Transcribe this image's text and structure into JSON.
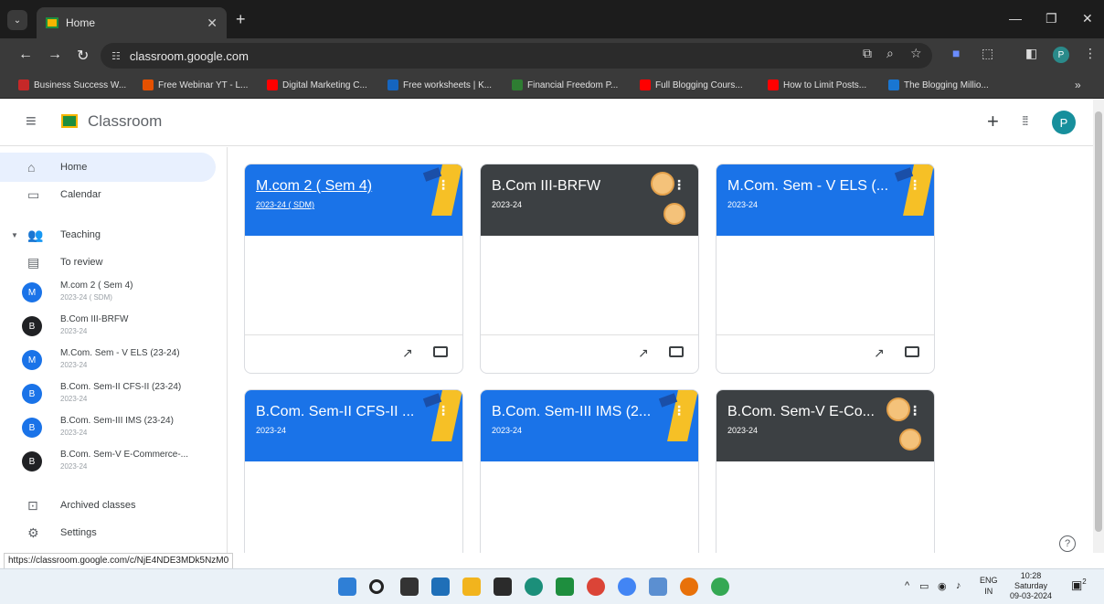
{
  "browser": {
    "tab_title": "Home",
    "url": "classroom.google.com",
    "bookmarks": [
      {
        "label": "Business Success W...",
        "color": "#c62828"
      },
      {
        "label": "Free Webinar YT - L...",
        "color": "#e65100"
      },
      {
        "label": "Digital Marketing C...",
        "color": "#ff0000"
      },
      {
        "label": "Free worksheets | K...",
        "color": "#1565c0"
      },
      {
        "label": "Financial Freedom P...",
        "color": "#2e7d32"
      },
      {
        "label": "Full Blogging Cours...",
        "color": "#ff0000"
      },
      {
        "label": "How to Limit Posts...",
        "color": "#ff0000"
      },
      {
        "label": "The Blogging Millio...",
        "color": "#1976d2"
      }
    ],
    "profile_initial": "P"
  },
  "header": {
    "app_title": "Classroom",
    "avatar_initial": "P"
  },
  "sidebar": {
    "home": "Home",
    "calendar": "Calendar",
    "teaching": "Teaching",
    "to_review": "To review",
    "classes": [
      {
        "initial": "M",
        "name": "M.com 2 ( Sem 4)",
        "sub": "2023-24 ( SDM)",
        "color": "#1a73e8"
      },
      {
        "initial": "B",
        "name": "B.Com III-BRFW",
        "sub": "2023-24",
        "color": "#202124"
      },
      {
        "initial": "M",
        "name": "M.Com. Sem - V ELS (23-24)",
        "sub": "2023-24",
        "color": "#1a73e8"
      },
      {
        "initial": "B",
        "name": "B.Com. Sem-II CFS-II (23-24)",
        "sub": "2023-24",
        "color": "#1a73e8"
      },
      {
        "initial": "B",
        "name": "B.Com. Sem-III IMS (23-24)",
        "sub": "2023-24",
        "color": "#1a73e8"
      },
      {
        "initial": "B",
        "name": "B.Com. Sem-V E-Commerce-...",
        "sub": "2023-24",
        "color": "#202124"
      }
    ],
    "archived": "Archived classes",
    "settings": "Settings"
  },
  "cards": [
    {
      "title": "M.com 2 ( Sem 4)",
      "sub": "2023-24 ( SDM)",
      "bg": "#1a73e8",
      "theme": "blue"
    },
    {
      "title": "B.Com III-BRFW",
      "sub": "2023-24",
      "bg": "#3c4043",
      "theme": "dark"
    },
    {
      "title": "M.Com. Sem - V ELS (...",
      "sub": "2023-24",
      "bg": "#1a73e8",
      "theme": "blue"
    },
    {
      "title": "B.Com. Sem-II CFS-II ...",
      "sub": "2023-24",
      "bg": "#1a73e8",
      "theme": "blue"
    },
    {
      "title": "B.Com. Sem-III IMS (2...",
      "sub": "2023-24",
      "bg": "#1a73e8",
      "theme": "blue"
    },
    {
      "title": "B.Com. Sem-V E-Co...",
      "sub": "2023-24",
      "bg": "#3c4043",
      "theme": "dark"
    }
  ],
  "status_url": "https://classroom.google.com/c/NjE4NDE3MDk5NzM0",
  "taskbar": {
    "lang_top": "ENG",
    "lang_bottom": "IN",
    "time": "10:28",
    "day": "Saturday",
    "date": "09-03-2024",
    "notifications": "2"
  }
}
